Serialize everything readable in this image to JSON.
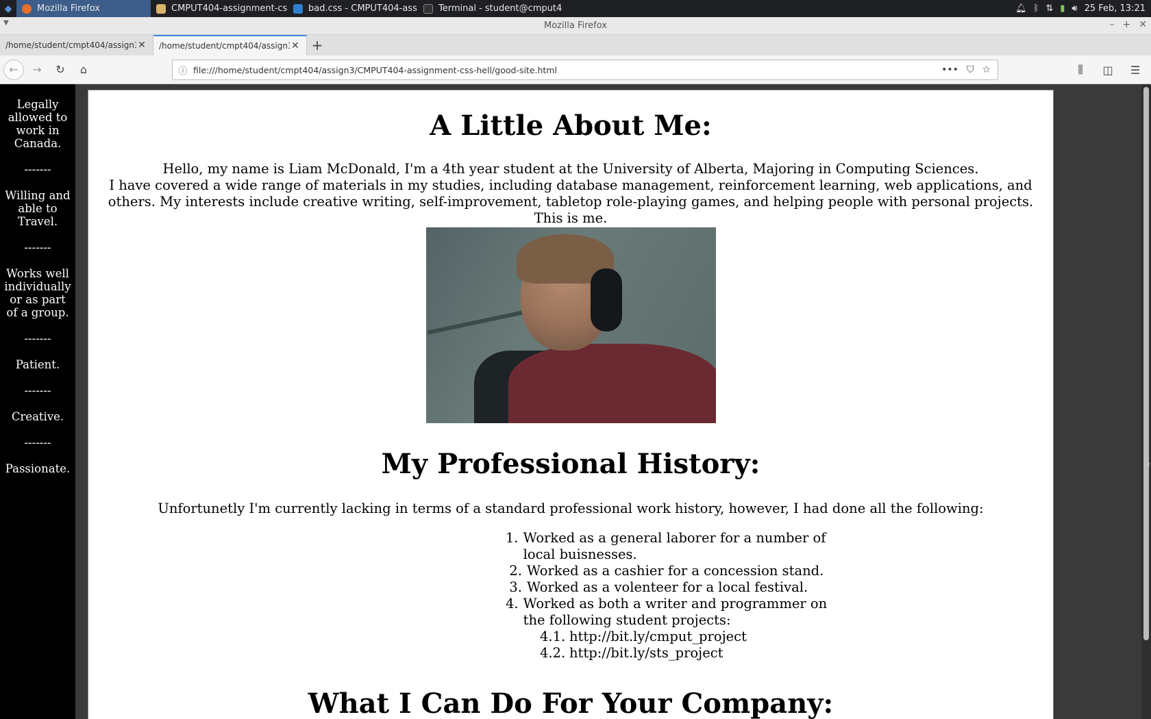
{
  "taskbar": {
    "tasks": [
      {
        "label": "Mozilla Firefox",
        "icon": "firefox-icon",
        "color": "#e8702a"
      },
      {
        "label": "CMPUT404-assignment-css-...",
        "icon": "folder-icon",
        "color": "#d9b36a"
      },
      {
        "label": "bad.css - CMPUT404-assign...",
        "icon": "vscode-icon",
        "color": "#2f80d1"
      },
      {
        "label": "Terminal - student@cmput40...",
        "icon": "terminal-icon",
        "color": "#333333"
      }
    ],
    "clock": "25 Feb, 13:21"
  },
  "window": {
    "title": "Mozilla Firefox",
    "minimize": "–",
    "maximize": "+",
    "close": "✕"
  },
  "tabs": [
    {
      "label": "/home/student/cmpt404/assign3/",
      "active": false
    },
    {
      "label": "/home/student/cmpt404/assign3/",
      "active": true
    }
  ],
  "nav": {
    "url": "file:///home/student/cmpt404/assign3/CMPUT404-assignment-css-hell/good-site.html"
  },
  "sidebar": {
    "items": [
      "Legally allowed to work in Canada.",
      "Willing and able to Travel.",
      "Works well individually or as part of a group.",
      "Patient.",
      "Creative.",
      "Passionate."
    ],
    "separator": "-------"
  },
  "page": {
    "about_title": "A Little About Me:",
    "intro_line1": "Hello, my name is Liam McDonald, I'm a 4th year student at the University of Alberta, Majoring in Computing Sciences.",
    "intro_line2": "I have covered a wide range of materials in my studies, including database management, reinforcement learning, web applications, and others. My interests include creative writing, self-improvement, tabletop role-playing games, and helping people with personal projects.",
    "intro_line3": "This is me.",
    "history_title": "My Professional History:",
    "history_intro": "Unfortunetly I'm currently lacking in terms of a standard professional work history, however, I had done all the following:",
    "history_items": [
      {
        "num": "1.",
        "text": "Worked as a general laborer for a number of local buisnesses."
      },
      {
        "num": "2.",
        "text": "Worked as a cashier for a concession stand."
      },
      {
        "num": "3.",
        "text": "Worked as a volenteer for a local festival."
      },
      {
        "num": "4.",
        "text": "Worked as both a writer and programmer on the following student projects:"
      }
    ],
    "project_links": [
      {
        "num": "4.1.",
        "text": "http://bit.ly/cmput_project"
      },
      {
        "num": "4.2.",
        "text": "http://bit.ly/sts_project"
      }
    ],
    "company_title": "What I Can Do For Your Company:"
  }
}
